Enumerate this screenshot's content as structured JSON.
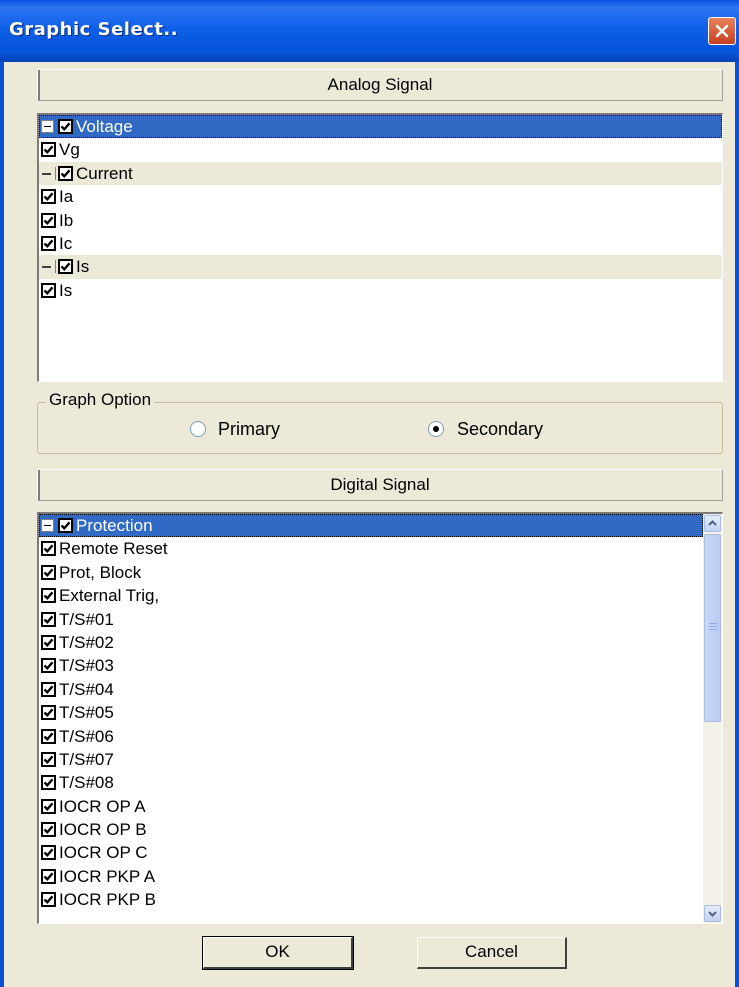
{
  "window": {
    "title": "Graphic Select..",
    "close_icon": "close-icon"
  },
  "analog": {
    "header": "Analog Signal",
    "items": [
      {
        "label": "Voltage",
        "type": "group",
        "checked": true,
        "selected": true
      },
      {
        "label": "Vg",
        "type": "item",
        "checked": true
      },
      {
        "label": "Current",
        "type": "group",
        "checked": true
      },
      {
        "label": "Ia",
        "type": "item",
        "checked": true
      },
      {
        "label": "Ib",
        "type": "item",
        "checked": true
      },
      {
        "label": "Ic",
        "type": "item",
        "checked": true
      },
      {
        "label": "Is",
        "type": "group",
        "checked": true
      },
      {
        "label": "Is",
        "type": "item",
        "checked": true
      }
    ]
  },
  "graph_option": {
    "title": "Graph Option",
    "primary_label": "Primary",
    "secondary_label": "Secondary",
    "selected": "Secondary"
  },
  "digital": {
    "header": "Digital Signal",
    "items": [
      {
        "label": "Protection",
        "type": "group",
        "checked": true,
        "selected": true
      },
      {
        "label": "Remote Reset",
        "type": "item",
        "checked": true
      },
      {
        "label": "Prot, Block",
        "type": "item",
        "checked": true
      },
      {
        "label": "External Trig,",
        "type": "item",
        "checked": true
      },
      {
        "label": "T/S#01",
        "type": "item",
        "checked": true
      },
      {
        "label": "T/S#02",
        "type": "item",
        "checked": true
      },
      {
        "label": "T/S#03",
        "type": "item",
        "checked": true
      },
      {
        "label": "T/S#04",
        "type": "item",
        "checked": true
      },
      {
        "label": "T/S#05",
        "type": "item",
        "checked": true
      },
      {
        "label": "T/S#06",
        "type": "item",
        "checked": true
      },
      {
        "label": "T/S#07",
        "type": "item",
        "checked": true
      },
      {
        "label": "T/S#08",
        "type": "item",
        "checked": true
      },
      {
        "label": "IOCR OP A",
        "type": "item",
        "checked": true
      },
      {
        "label": "IOCR OP B",
        "type": "item",
        "checked": true
      },
      {
        "label": "IOCR OP C",
        "type": "item",
        "checked": true
      },
      {
        "label": "IOCR PKP A",
        "type": "item",
        "checked": true
      },
      {
        "label": "IOCR PKP B",
        "type": "item",
        "checked": true
      }
    ]
  },
  "buttons": {
    "ok": "OK",
    "cancel": "Cancel"
  }
}
